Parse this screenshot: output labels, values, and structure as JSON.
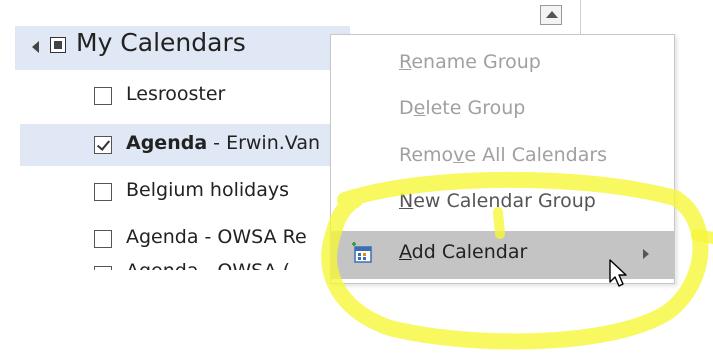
{
  "calendar_pane": {
    "group": {
      "label": "My Calendars",
      "expanded": true
    },
    "items": [
      {
        "name": "Lesrooster",
        "suffix": "",
        "checked": false,
        "bold": false,
        "selected": false
      },
      {
        "name": "Agenda",
        "suffix": " - Erwin.Van",
        "checked": true,
        "bold": true,
        "selected": true
      },
      {
        "name": "Belgium holidays",
        "suffix": "",
        "checked": false,
        "bold": false,
        "selected": false
      },
      {
        "name": "Agenda - OWSA Re",
        "suffix": "",
        "checked": false,
        "bold": false,
        "selected": false
      },
      {
        "name": "Agenda - OWSA (",
        "suffix": "",
        "checked": false,
        "bold": false,
        "selected": false
      }
    ]
  },
  "context_menu": {
    "items": [
      {
        "pre": "",
        "key": "R",
        "post": "ename Group",
        "enabled": false
      },
      {
        "pre": "D",
        "key": "e",
        "post": "lete Group",
        "enabled": false
      },
      {
        "pre": "Remo",
        "key": "v",
        "post": "e All Calendars",
        "enabled": false
      },
      {
        "pre": "",
        "key": "N",
        "post": "ew Calendar Group",
        "enabled": true
      },
      {
        "pre": "",
        "key": "A",
        "post": "dd Calendar",
        "enabled": true,
        "hover": true,
        "submenu": true,
        "icon": "add-calendar-icon"
      }
    ]
  },
  "colors": {
    "selection": "#dfe8f4",
    "menu_hover": "#c4c4c4",
    "annotation": "#f6f63a"
  }
}
